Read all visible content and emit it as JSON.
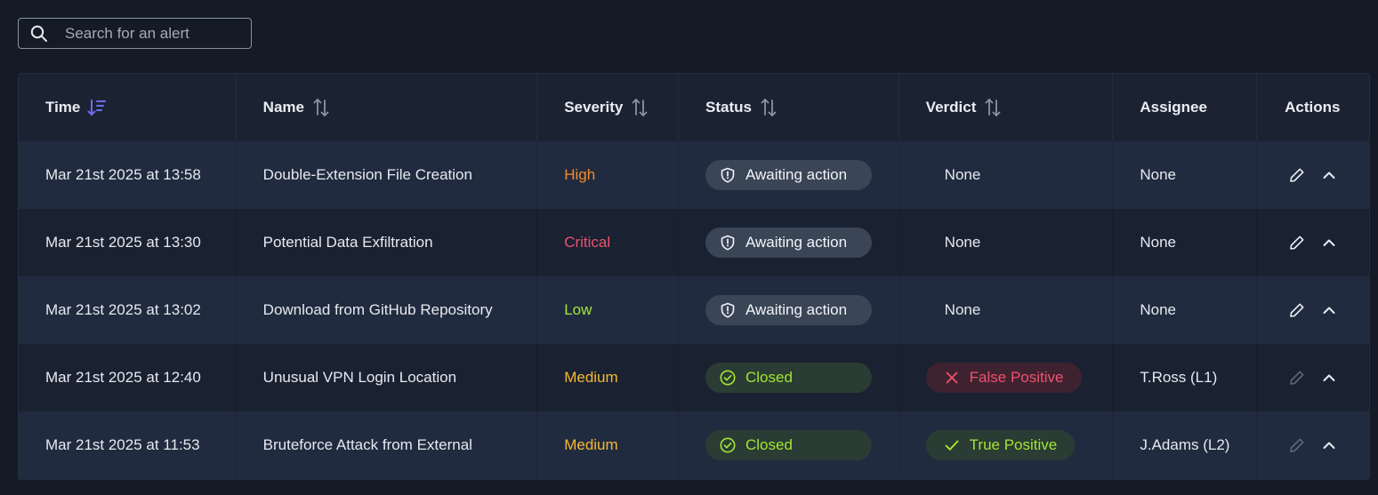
{
  "search": {
    "placeholder": "Search for an alert",
    "value": ""
  },
  "columns": {
    "time": "Time",
    "name": "Name",
    "severity": "Severity",
    "status": "Status",
    "verdict": "Verdict",
    "assignee": "Assignee",
    "actions": "Actions"
  },
  "colors": {
    "High": "#f58b2e",
    "Critical": "#f0506e",
    "Low": "#a3e635",
    "Medium": "#f5b82e",
    "sort_active": "#6d6df0"
  },
  "rows": [
    {
      "time": "Mar 21st 2025 at 13:58",
      "name": "Double-Extension File Creation",
      "severity": "High",
      "status": "Awaiting action",
      "status_type": "awaiting",
      "verdict": "None",
      "verdict_type": "none",
      "assignee": "None",
      "edit_enabled": true
    },
    {
      "time": "Mar 21st 2025 at 13:30",
      "name": "Potential Data Exfiltration",
      "severity": "Critical",
      "status": "Awaiting action",
      "status_type": "awaiting",
      "verdict": "None",
      "verdict_type": "none",
      "assignee": "None",
      "edit_enabled": true
    },
    {
      "time": "Mar 21st 2025 at 13:02",
      "name": "Download from GitHub Repository",
      "severity": "Low",
      "status": "Awaiting action",
      "status_type": "awaiting",
      "verdict": "None",
      "verdict_type": "none",
      "assignee": "None",
      "edit_enabled": true
    },
    {
      "time": "Mar 21st 2025 at 12:40",
      "name": "Unusual VPN Login Location",
      "severity": "Medium",
      "status": "Closed",
      "status_type": "closed",
      "verdict": "False Positive",
      "verdict_type": "fp",
      "assignee": "T.Ross (L1)",
      "edit_enabled": false
    },
    {
      "time": "Mar 21st 2025 at 11:53",
      "name": "Bruteforce Attack from External",
      "severity": "Medium",
      "status": "Closed",
      "status_type": "closed",
      "verdict": "True Positive",
      "verdict_type": "tp",
      "assignee": "J.Adams (L2)",
      "edit_enabled": false
    }
  ]
}
